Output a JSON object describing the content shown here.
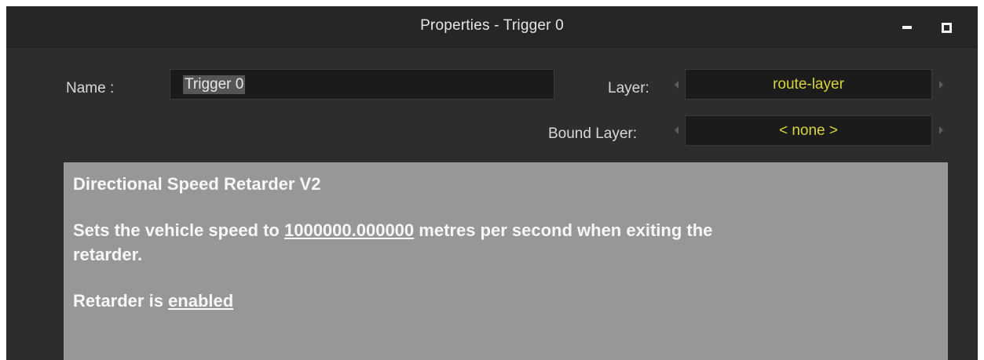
{
  "window": {
    "title": "Properties - Trigger 0"
  },
  "titlebar_buttons": {
    "minimize": "minimize-icon",
    "maximize": "maximize-icon"
  },
  "name_field": {
    "label": "Name :",
    "value": "Trigger 0"
  },
  "layer": {
    "label": "Layer:",
    "value": "route-layer"
  },
  "bound_layer": {
    "label": "Bound Layer:",
    "value": "< none >"
  },
  "description": {
    "title": "Directional Speed Retarder V2",
    "speed_prefix": "Sets the vehicle speed to ",
    "speed_value": "1000000.000000",
    "speed_suffix_1": " metres per second when exiting the",
    "speed_suffix_2": "retarder.",
    "status_prefix": "Retarder is ",
    "status_value": "enabled"
  },
  "colors": {
    "combo_text": "#d9d43b",
    "panel_bg": "#979797",
    "window_bg": "#2d2d2d"
  }
}
